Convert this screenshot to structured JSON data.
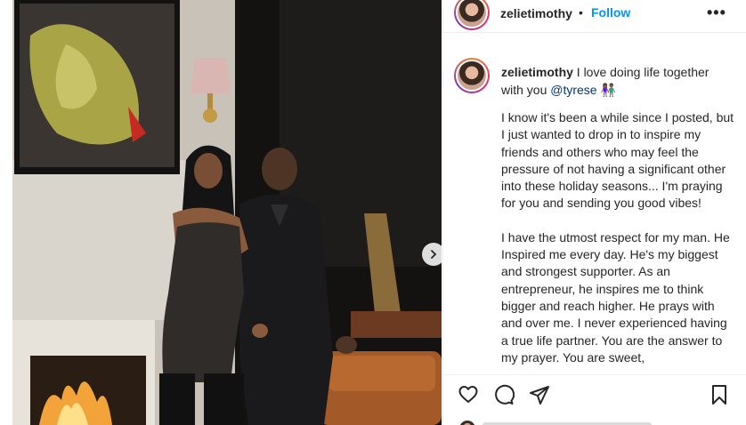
{
  "post": {
    "username": "zelietimothy",
    "follow_label": "Follow",
    "more_label": "•••",
    "header_separator": "•"
  },
  "caption": {
    "username": "zelietimothy",
    "text_before_mention": " I love doing life together with you ",
    "mention": "@tyrese",
    "emoji": "👫🏾",
    "paragraphs": [
      "I know it's been a while since I posted, but I just wanted to drop in to inspire my friends and others who may feel the pressure of not having a significant other into these holiday seasons... I'm praying for you and sending you good vibes!",
      "I have the utmost respect for my man. He Inspired me every day. He's my biggest and strongest supporter. As an entrepreneur, he inspires me to think bigger and reach higher. He prays with and over me. I never experienced having a true life partner. You are the answer to my prayer. You are sweet,"
    ]
  },
  "icons": {
    "like": "heart-icon",
    "comment": "comment-icon",
    "share": "share-icon",
    "save": "bookmark-icon",
    "next": "chevron-right-icon"
  },
  "colors": {
    "follow_blue": "#0095f6",
    "mention": "#00376b",
    "divider": "#efefef"
  }
}
